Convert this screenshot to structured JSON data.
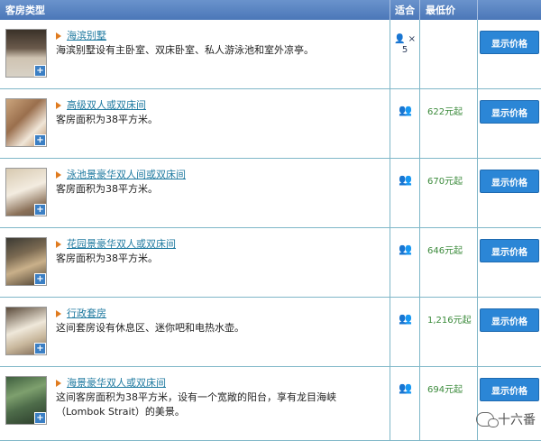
{
  "header": {
    "room_type": "客房类型",
    "fits": "适合",
    "lowest_price": "最低价"
  },
  "rooms": [
    {
      "title": "海滨别墅",
      "description": "海滨别墅设有主卧室、双床卧室、私人游泳池和室外凉亭。",
      "occupancy": "×",
      "occupancy_count": "5",
      "price": "",
      "button": "显示价格"
    },
    {
      "title": "高级双人或双床间",
      "description": "客房面积为38平方米。",
      "occupancy": "2",
      "price": "622元起",
      "button": "显示价格"
    },
    {
      "title": "泳池景豪华双人间或双床间",
      "description": "客房面积为38平方米。",
      "occupancy": "2",
      "price": "670元起",
      "button": "显示价格"
    },
    {
      "title": "花园景豪华双人或双床间",
      "description": "客房面积为38平方米。",
      "occupancy": "2",
      "price": "646元起",
      "button": "显示价格"
    },
    {
      "title": "行政套房",
      "description": "这间套房设有休息区、迷你吧和电热水壶。",
      "occupancy": "2",
      "price": "1,216元起",
      "button": "显示价格"
    },
    {
      "title": "海景豪华双人或双床间",
      "description": "这间客房面积为38平方米，设有一个宽敞的阳台，享有龙目海峡（Lombok Strait）的美景。",
      "occupancy": "2",
      "price": "694元起",
      "button": "显示价格"
    }
  ],
  "watermark": "十六番",
  "colors": {
    "header_bg": "#4b77b8",
    "button_bg": "#2b86d6",
    "price_text": "#3a8a3a",
    "link_text": "#1f7aa0",
    "bullet": "#e07b1f"
  }
}
